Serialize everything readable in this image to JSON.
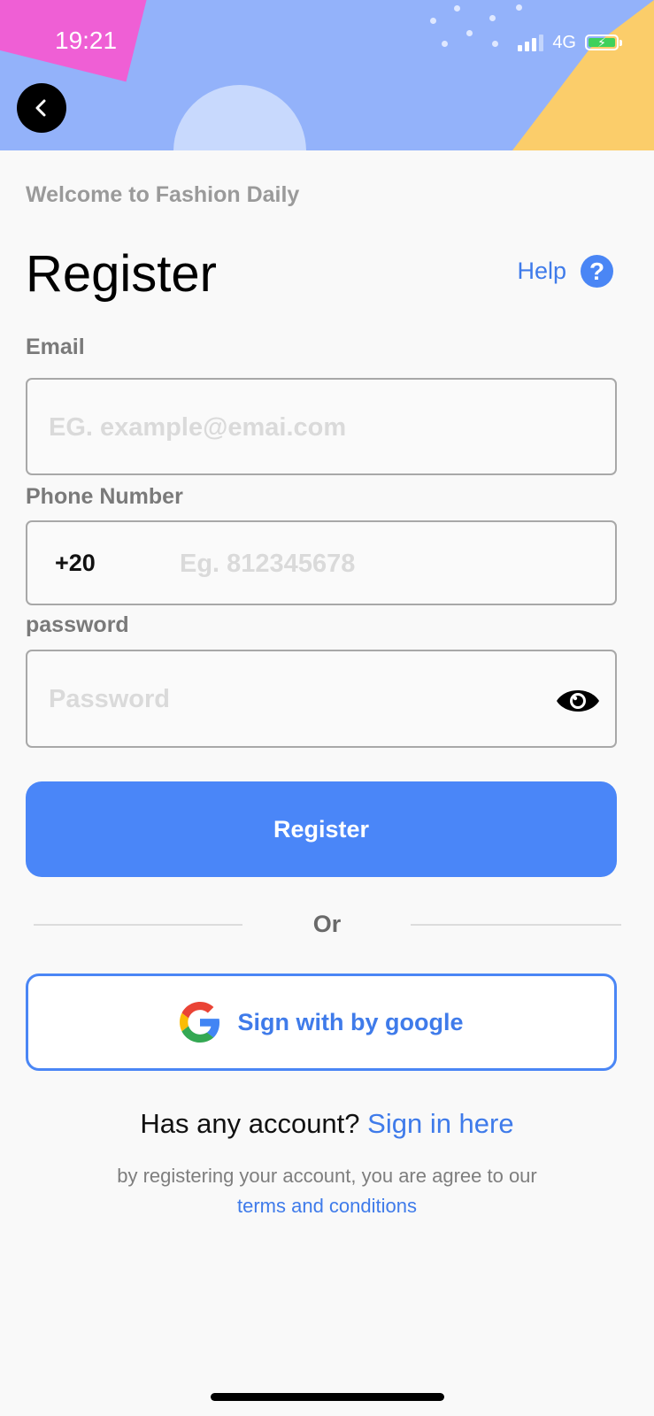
{
  "status_bar": {
    "time": "19:21",
    "network": "4G"
  },
  "header": {
    "welcome": "Welcome to Fashion Daily",
    "title": "Register",
    "help_label": "Help",
    "help_icon_glyph": "?"
  },
  "form": {
    "email": {
      "label": "Email",
      "placeholder": "EG. example@emai.com",
      "value": ""
    },
    "phone": {
      "label": "Phone Number",
      "country_code": "+20",
      "placeholder": "Eg. 812345678",
      "value": ""
    },
    "password": {
      "label": "password",
      "placeholder": "Password",
      "value": ""
    },
    "register_button": "Register"
  },
  "divider_text": "Or",
  "google_button": "Sign with by google",
  "footer": {
    "account_question": "Has any account?",
    "sign_in_link": "Sign in here",
    "terms_text": "by registering your account, you are agree to our",
    "terms_link": "terms and conditions"
  },
  "colors": {
    "accent": "#4a86f8",
    "link": "#3f7bea",
    "header_bg": "#93b2fa",
    "pink_shape": "#ef5fd5",
    "yellow_shape": "#fbcd6a"
  },
  "icons": [
    "back-arrow-icon",
    "help-icon",
    "eye-icon",
    "google-logo-icon",
    "signal-icon",
    "battery-charging-icon"
  ]
}
